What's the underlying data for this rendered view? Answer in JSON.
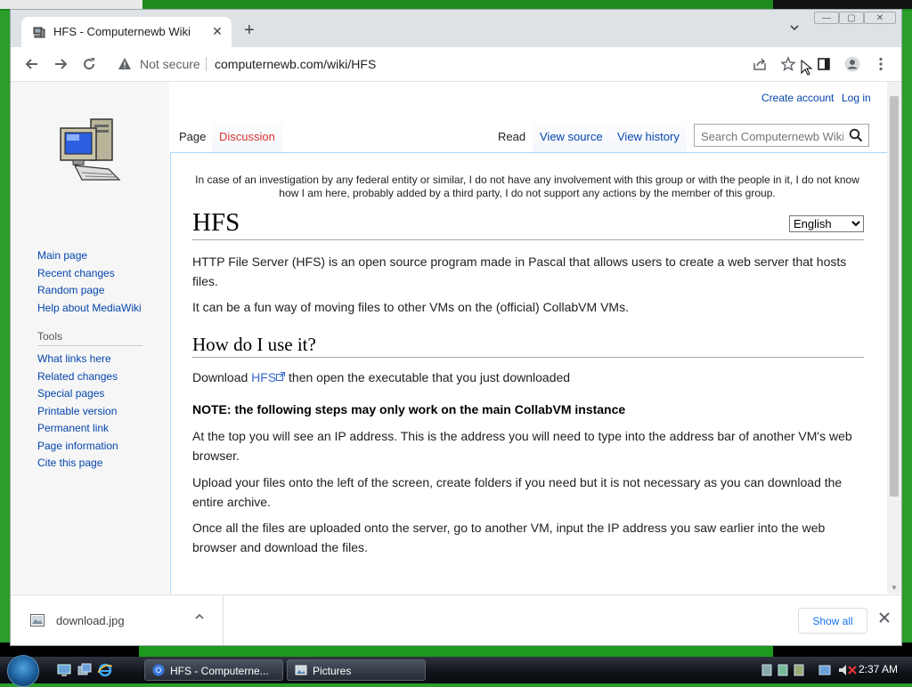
{
  "browser": {
    "tab_title": "HFS - Computernewb Wiki",
    "tab_close": "✕",
    "new_tab": "+",
    "tab_search_icon": "chevron-down-icon",
    "security_label": "Not secure",
    "url": "computernewb.com/wiki/HFS"
  },
  "wiki": {
    "personal": {
      "create_account": "Create account",
      "log_in": "Log in"
    },
    "tabs": {
      "page": "Page",
      "discussion": "Discussion",
      "read": "Read",
      "view_source": "View source",
      "view_history": "View history"
    },
    "search_placeholder": "Search Computernewb Wiki",
    "navigation": [
      "Main page",
      "Recent changes",
      "Random page",
      "Help about MediaWiki"
    ],
    "tools_heading": "Tools",
    "tools": [
      "What links here",
      "Related changes",
      "Special pages",
      "Printable version",
      "Permanent link",
      "Page information",
      "Cite this page"
    ],
    "site_notice": "In case of an investigation by any federal entity or similar, I do not have any involvement with this group or with the people in it, I do not know how I am here, probably added by a third party, I do not support any actions by the member of this group.",
    "language_selected": "English",
    "title": "HFS",
    "intro_p1": "HTTP File Server (HFS) is an open source program made in Pascal that allows users to create a web server that hosts files.",
    "intro_p2": "It can be a fun way of moving files to other VMs on the (official) CollabVM VMs.",
    "section_heading": "How do I use it?",
    "download_prefix": "Download ",
    "download_link": "HFS",
    "download_suffix": " then open the executable that you just downloaded",
    "note": "NOTE: the following steps may only work on the main CollabVM instance",
    "step1": "At the top you will see an IP address. This is the address you will need to type into the address bar of another VM's web browser.",
    "step2": "Upload your files onto the left of the screen, create folders if you need but it is not necessary as you can download the entire archive.",
    "step3": "Once all the files are uploaded onto the server, go to another VM, input the IP address you saw earlier into the web browser and download the files."
  },
  "downloads": {
    "file_name": "download.jpg",
    "show_all": "Show all"
  },
  "taskbar": {
    "items": [
      "HFS - Computerne...",
      "Pictures"
    ],
    "clock": "2:37 AM"
  }
}
